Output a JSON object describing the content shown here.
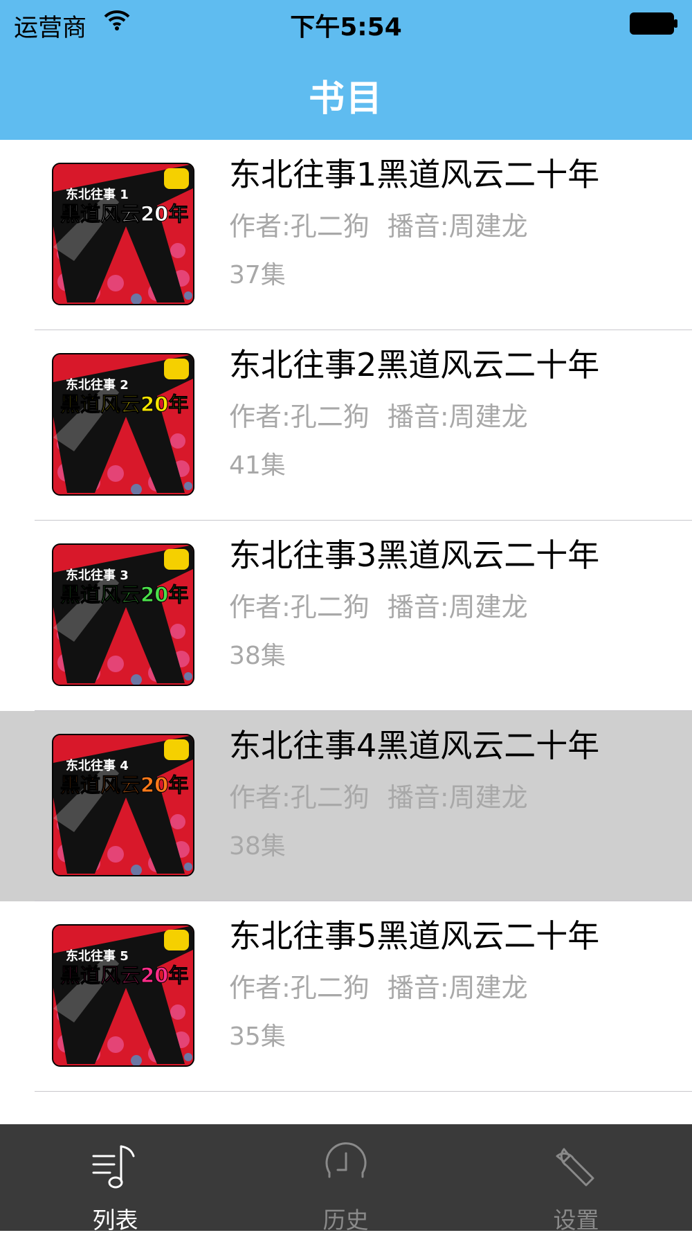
{
  "status_bar": {
    "carrier": "运营商",
    "time": "下午5:54"
  },
  "nav": {
    "title": "书目"
  },
  "books": [
    {
      "title": "东北往事1黑道风云二十年",
      "author": "作者:孔二狗",
      "narrator": "播音:周建龙",
      "episodes": "37集",
      "cover_top": "东北往事 1",
      "cover_main": "黑道风云20年",
      "cover_color": "#ffffff",
      "selected": false
    },
    {
      "title": "东北往事2黑道风云二十年",
      "author": "作者:孔二狗",
      "narrator": "播音:周建龙",
      "episodes": "41集",
      "cover_top": "东北往事 2",
      "cover_main": "黑道风云20年",
      "cover_color": "#f5e400",
      "selected": false
    },
    {
      "title": "东北往事3黑道风云二十年",
      "author": "作者:孔二狗",
      "narrator": "播音:周建龙",
      "episodes": "38集",
      "cover_top": "东北往事 3",
      "cover_main": "黑道风云20年",
      "cover_color": "#4be04b",
      "selected": false
    },
    {
      "title": "东北往事4黑道风云二十年",
      "author": "作者:孔二狗",
      "narrator": "播音:周建龙",
      "episodes": "38集",
      "cover_top": "东北往事 4",
      "cover_main": "黑道风云20年",
      "cover_color": "#ff7a1a",
      "selected": true
    },
    {
      "title": "东北往事5黑道风云二十年",
      "author": "作者:孔二狗",
      "narrator": "播音:周建龙",
      "episodes": "35集",
      "cover_top": "东北往事 5",
      "cover_main": "黑道风云20年",
      "cover_color": "#ff2d8a",
      "selected": false
    }
  ],
  "tabs": [
    {
      "label": "列表",
      "icon": "music-list-icon",
      "active": true
    },
    {
      "label": "历史",
      "icon": "clock-icon",
      "active": false
    },
    {
      "label": "设置",
      "icon": "wrench-icon",
      "active": false
    }
  ],
  "colors": {
    "nav_blue": "#5fbcf0",
    "tabbar": "#3a3a3a",
    "selected_row": "#cfcfcf",
    "cover_red": "#d8182a"
  }
}
